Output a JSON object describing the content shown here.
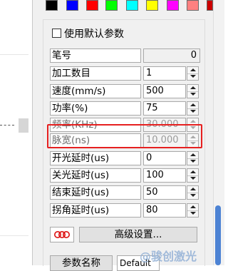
{
  "swatches": [
    "#000000",
    "#0000ff",
    "#ff0000",
    "#00ff00",
    "#00ffff",
    "#ffff00",
    "#ff00ff",
    "#ff8080",
    "#cc0000"
  ],
  "use_default_label": "使用默认参数",
  "params": [
    {
      "label": "笔号",
      "value": "0",
      "kind": "readonly"
    },
    {
      "label": "加工数目",
      "value": "1",
      "kind": "spin"
    },
    {
      "label": "速度(mm/s)",
      "value": "500",
      "kind": "spin"
    },
    {
      "label": "功率(%)",
      "value": "75",
      "kind": "spin"
    },
    {
      "label": "频率(KHz)",
      "value": "30.000",
      "kind": "disabled"
    },
    {
      "label": "脉宽(ns)",
      "value": "10.000",
      "kind": "disabled"
    },
    {
      "label": "开光延时(us)",
      "value": "0",
      "kind": "spin"
    },
    {
      "label": "关光延时(us)",
      "value": "100",
      "kind": "spin"
    },
    {
      "label": "结束延时(us)",
      "value": "50",
      "kind": "spin"
    },
    {
      "label": "拐角延时(us)",
      "value": "80",
      "kind": "spin"
    }
  ],
  "advanced_button": "高级设置...",
  "param_name_button": "参数名称",
  "default_value": "Default",
  "watermark": "@骏创激光"
}
